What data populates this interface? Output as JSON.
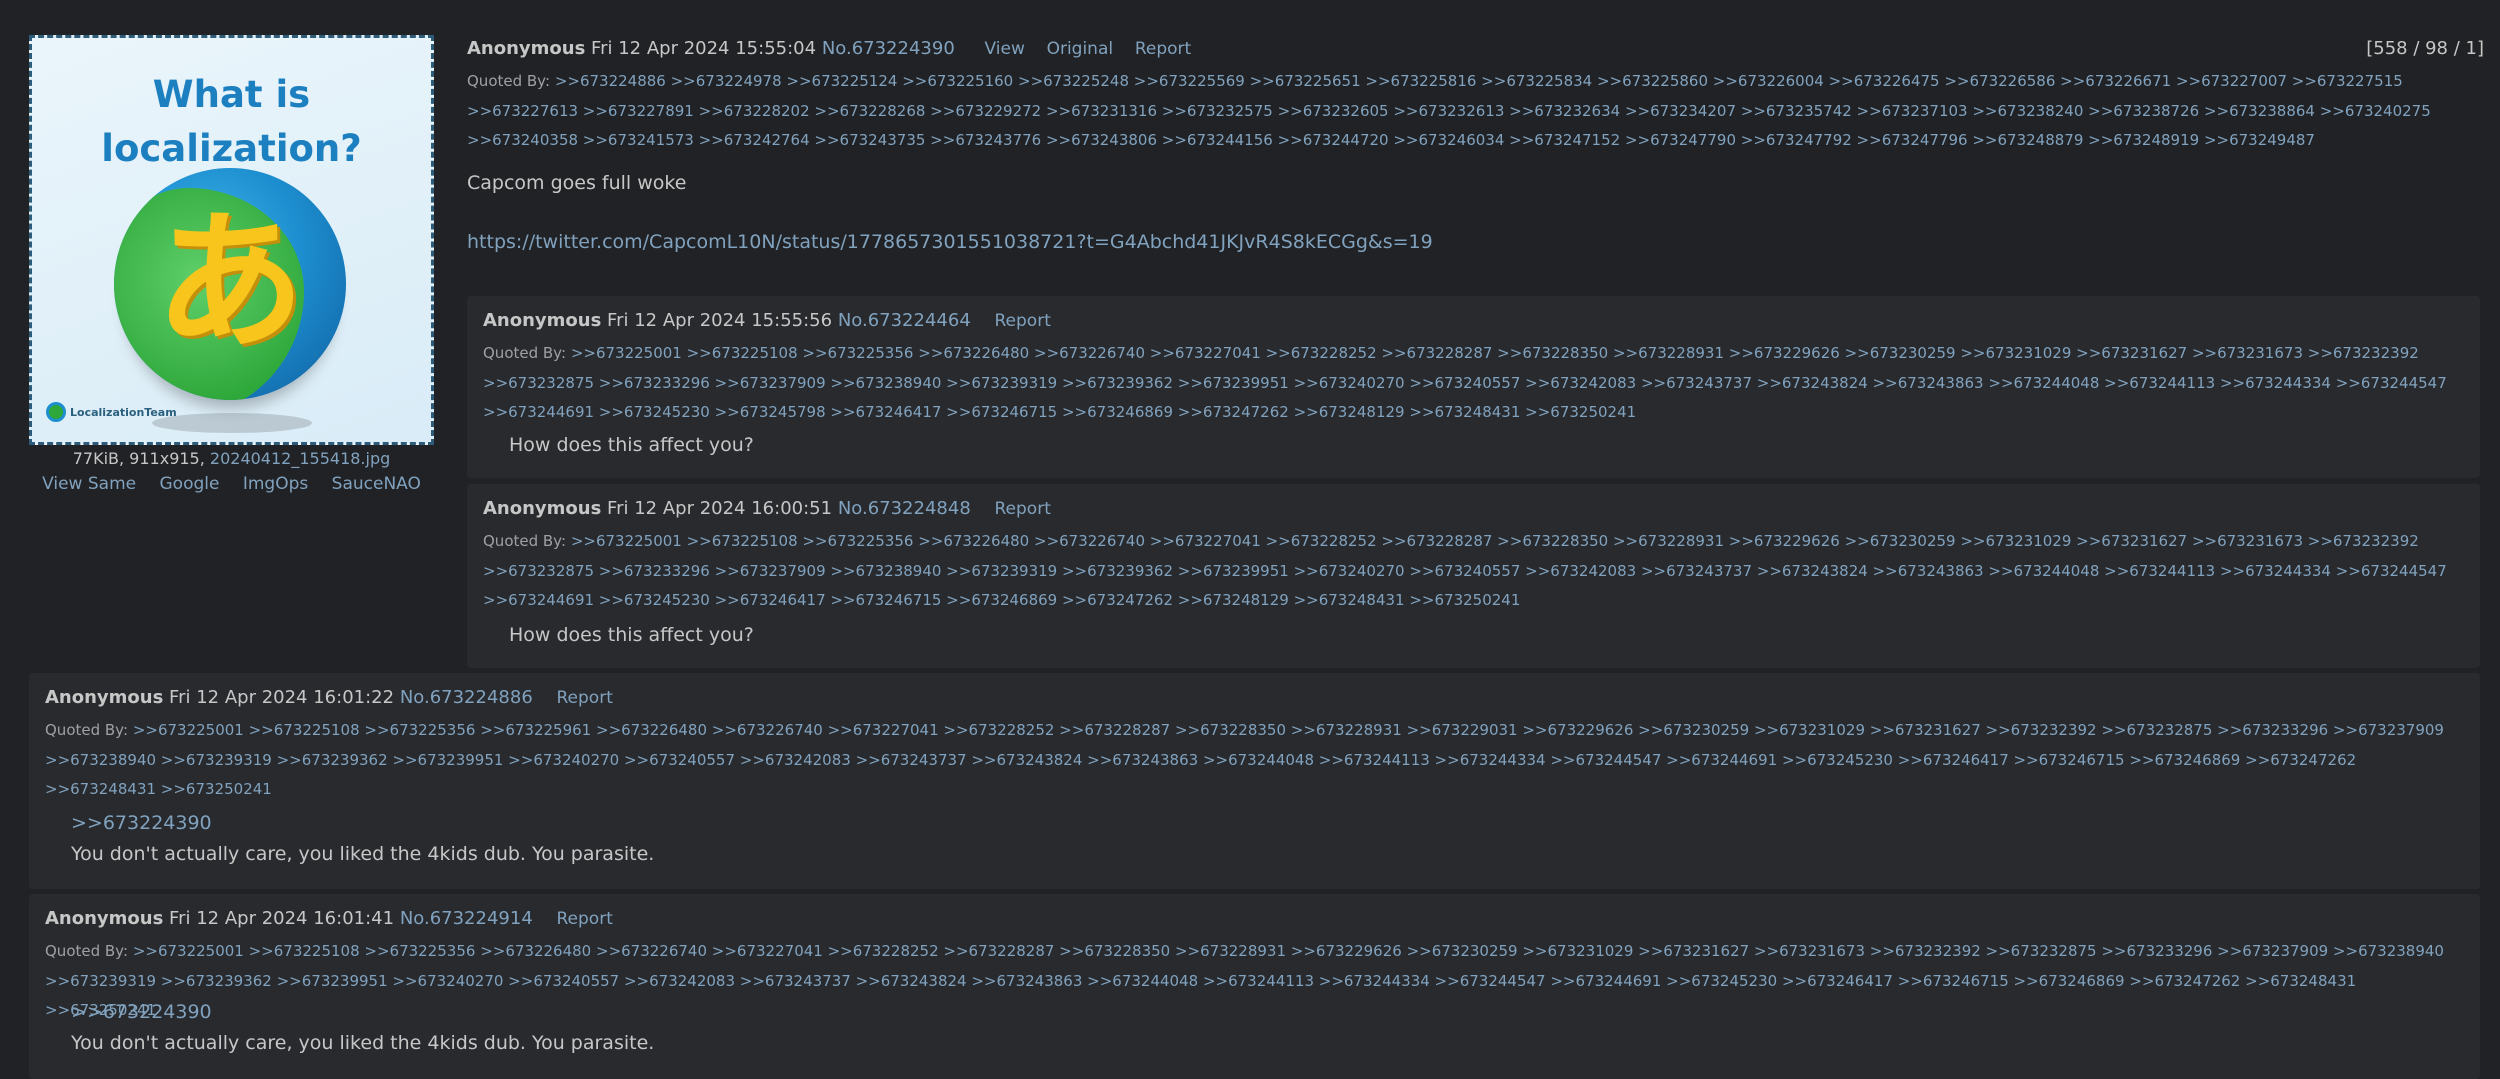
{
  "op": {
    "thumbnail": {
      "title_line1": "What is",
      "title_line2": "localization?",
      "glyph": "あ",
      "brand": "LocalizationTeam"
    },
    "file_info_prefix": "77KiB, 911x915, ",
    "file_name": "20240412_155418.jpg",
    "file_actions": [
      "View Same",
      "Google",
      "ImgOps",
      "SauceNAO"
    ],
    "name": "Anonymous",
    "date": "Fri 12 Apr 2024 15:55:04",
    "number": "No.673224390",
    "actions": [
      "View",
      "Original",
      "Report"
    ],
    "reply_count": "[558 / 98 / 1]",
    "quoted_label": "Quoted By:",
    "quoted_by": ">>673224886 >>673224978 >>673225124 >>673225160 >>673225248 >>673225569 >>673225651 >>673225816 >>673225834 >>673225860 >>673226004 >>673226475 >>673226586 >>673226671 >>673227007 >>673227515 >>673227613 >>673227891 >>673228202 >>673228268 >>673229272 >>673231316 >>673232575 >>673232605 >>673232613 >>673232634 >>673234207 >>673235742 >>673237103 >>673238240 >>673238726 >>673238864 >>673240275 >>673240358 >>673241573 >>673242764 >>673243735 >>673243776 >>673243806 >>673244156 >>673244720 >>673246034 >>673247152 >>673247790 >>673247792 >>673247796 >>673248879 >>673248919 >>673249487",
    "comment": "Capcom goes full woke",
    "link": "https://twitter.com/CapcomL10N/status/1778657301551038721?t=G4Abchd41JKJvR4S8kECGg&s=19"
  },
  "replies": [
    {
      "name": "Anonymous",
      "date": "Fri 12 Apr 2024 15:55:56",
      "number": "No.673224464",
      "report": "Report",
      "quoted_label": "Quoted By:",
      "quoted_by": ">>673225001 >>673225108 >>673225356 >>673226480 >>673226740 >>673227041 >>673228252 >>673228287 >>673228350 >>673228931 >>673229626 >>673230259 >>673231029 >>673231627 >>673231673 >>673232392 >>673232875 >>673233296 >>673237909 >>673238940 >>673239319 >>673239362 >>673239951 >>673240270 >>673240557 >>673242083 >>673243737 >>673243824 >>673243863 >>673244048 >>673244113 >>673244334 >>673244547 >>673244691 >>673245230 >>673245798 >>673246417 >>673246715 >>673246869 >>673247262 >>673248129 >>673248431 >>673250241",
      "quotelink": "",
      "comment": "How does this affect you?"
    },
    {
      "name": "Anonymous",
      "date": "Fri 12 Apr 2024 16:00:51",
      "number": "No.673224848",
      "report": "Report",
      "quoted_label": "Quoted By:",
      "quoted_by": ">>673225001 >>673225108 >>673225356 >>673226480 >>673226740 >>673227041 >>673228252 >>673228287 >>673228350 >>673228931 >>673229626 >>673230259 >>673231029 >>673231627 >>673231673 >>673232392 >>673232875 >>673233296 >>673237909 >>673238940 >>673239319 >>673239362 >>673239951 >>673240270 >>673240557 >>673242083 >>673243737 >>673243824 >>673243863 >>673244048 >>673244113 >>673244334 >>673244547 >>673244691 >>673245230 >>673246417 >>673246715 >>673246869 >>673247262 >>673248129 >>673248431 >>673250241",
      "quotelink": "",
      "comment": "How does this affect you?"
    },
    {
      "name": "Anonymous",
      "date": "Fri 12 Apr 2024 16:01:22",
      "number": "No.673224886",
      "report": "Report",
      "quoted_label": "Quoted By:",
      "quoted_by": ">>673225001 >>673225108 >>673225356 >>673225961 >>673226480 >>673226740 >>673227041 >>673228252 >>673228287 >>673228350 >>673228931 >>673229031 >>673229626 >>673230259 >>673231029 >>673231627 >>673232392 >>673232875 >>673233296 >>673237909 >>673238940 >>673239319 >>673239362 >>673239951 >>673240270 >>673240557 >>673242083 >>673243737 >>673243824 >>673243863 >>673244048 >>673244113 >>673244334 >>673244547 >>673244691 >>673245230 >>673246417 >>673246715 >>673246869 >>673247262 >>673248431 >>673250241",
      "quotelink": ">>673224390",
      "comment": "You don't actually care, you liked the 4kids dub. You parasite."
    },
    {
      "name": "Anonymous",
      "date": "Fri 12 Apr 2024 16:01:41",
      "number": "No.673224914",
      "report": "Report",
      "quoted_label": "Quoted By:",
      "quoted_by": ">>673225001 >>673225108 >>673225356 >>673226480 >>673226740 >>673227041 >>673228252 >>673228287 >>673228350 >>673228931 >>673229626 >>673230259 >>673231029 >>673231627 >>673231673 >>673232392 >>673232875 >>673233296 >>673237909 >>673238940 >>673239319 >>673239362 >>673239951 >>673240270 >>673240557 >>673242083 >>673243737 >>673243824 >>673243863 >>673244048 >>673244113 >>673244334 >>673244547 >>673244691 >>673245230 >>673246417 >>673246715 >>673246869 >>673247262 >>673248431 >>673250241",
      "quotelink": ">>673224390",
      "comment": "You don't actually care, you liked the 4kids dub. You parasite."
    }
  ]
}
